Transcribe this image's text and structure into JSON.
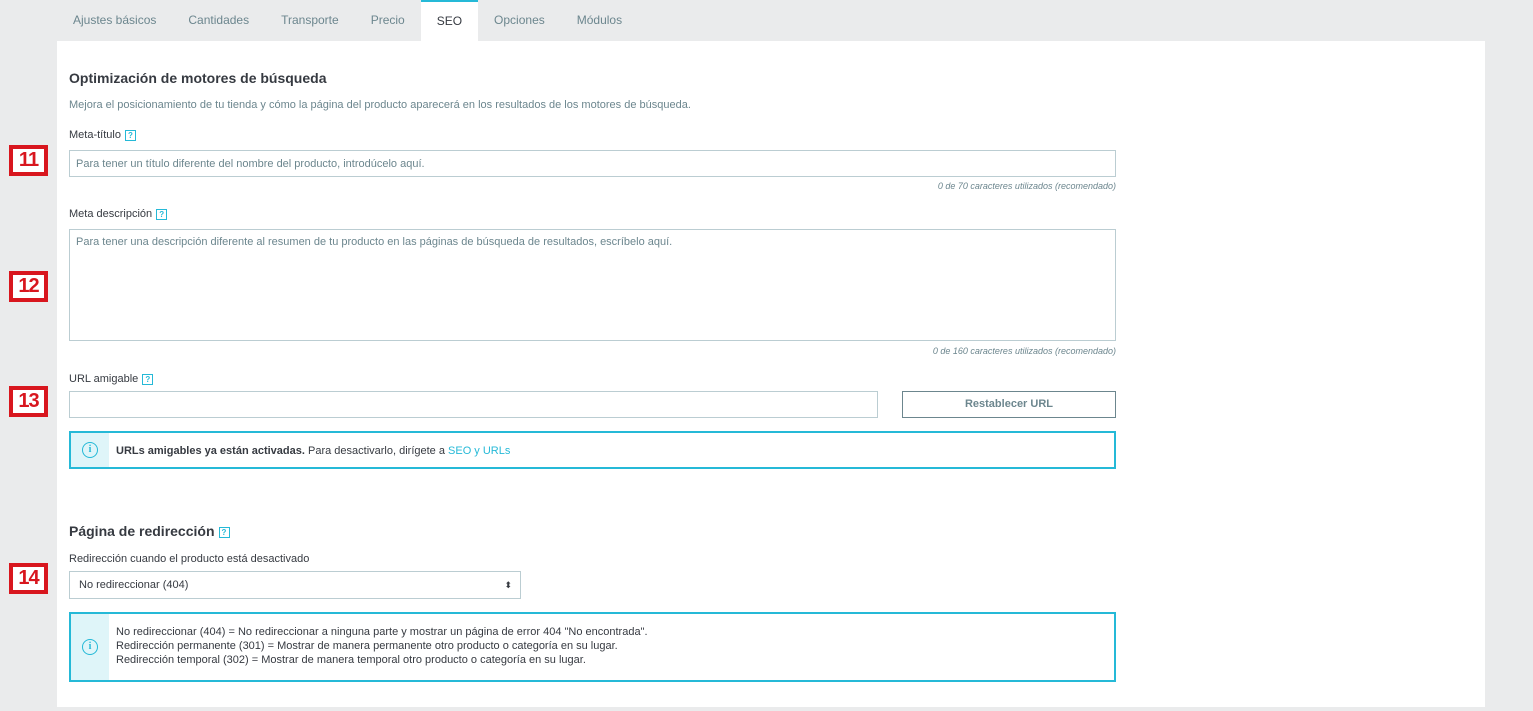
{
  "tabs": [
    "Ajustes básicos",
    "Cantidades",
    "Transporte",
    "Precio",
    "SEO",
    "Opciones",
    "Módulos"
  ],
  "seo": {
    "title": "Optimización de motores de búsqueda",
    "subtitle": "Mejora el posicionamiento de tu tienda y cómo la página del producto aparecerá en los resultados de los motores de búsqueda.",
    "meta_title_label": "Meta-título",
    "meta_title_placeholder": "Para tener un título diferente del nombre del producto, introdúcelo aquí.",
    "meta_title_counter": "0 de 70 caracteres utilizados (recomendado)",
    "meta_desc_label": "Meta descripción",
    "meta_desc_placeholder": "Para tener una descripción diferente al resumen de tu producto en las páginas de búsqueda de resultados, escríbelo aquí.",
    "meta_desc_counter": "0 de 160 caracteres utilizados (recomendado)",
    "url_label": "URL amigable",
    "url_value": "",
    "reset_url_button": "Restablecer URL",
    "url_alert_bold": "URLs amigables ya están activadas.",
    "url_alert_text": " Para desactivarlo, dirígete a ",
    "url_alert_link": "SEO y URLs"
  },
  "redirect": {
    "title": "Página de redirección",
    "label": "Redirección cuando el producto está desactivado",
    "selected": "No redireccionar (404)",
    "info_lines": [
      "No redireccionar (404) = No redireccionar a ninguna parte y mostrar un página de error 404 \"No encontrada\".",
      "Redirección permanente (301) = Mostrar de manera permanente otro producto o categoría en su lugar.",
      "Redirección temporal (302) = Mostrar de manera temporal otro producto o categoría en su lugar."
    ]
  },
  "help_glyph": "?",
  "info_glyph": "i",
  "select_caret": "⬍",
  "markers": [
    "11",
    "12",
    "13",
    "14"
  ],
  "colors": {
    "accent": "#25b9d7",
    "marker": "#d8161e"
  },
  "icons": {
    "help": "help-icon",
    "info": "info-icon",
    "caret": "caret-updown-icon"
  }
}
